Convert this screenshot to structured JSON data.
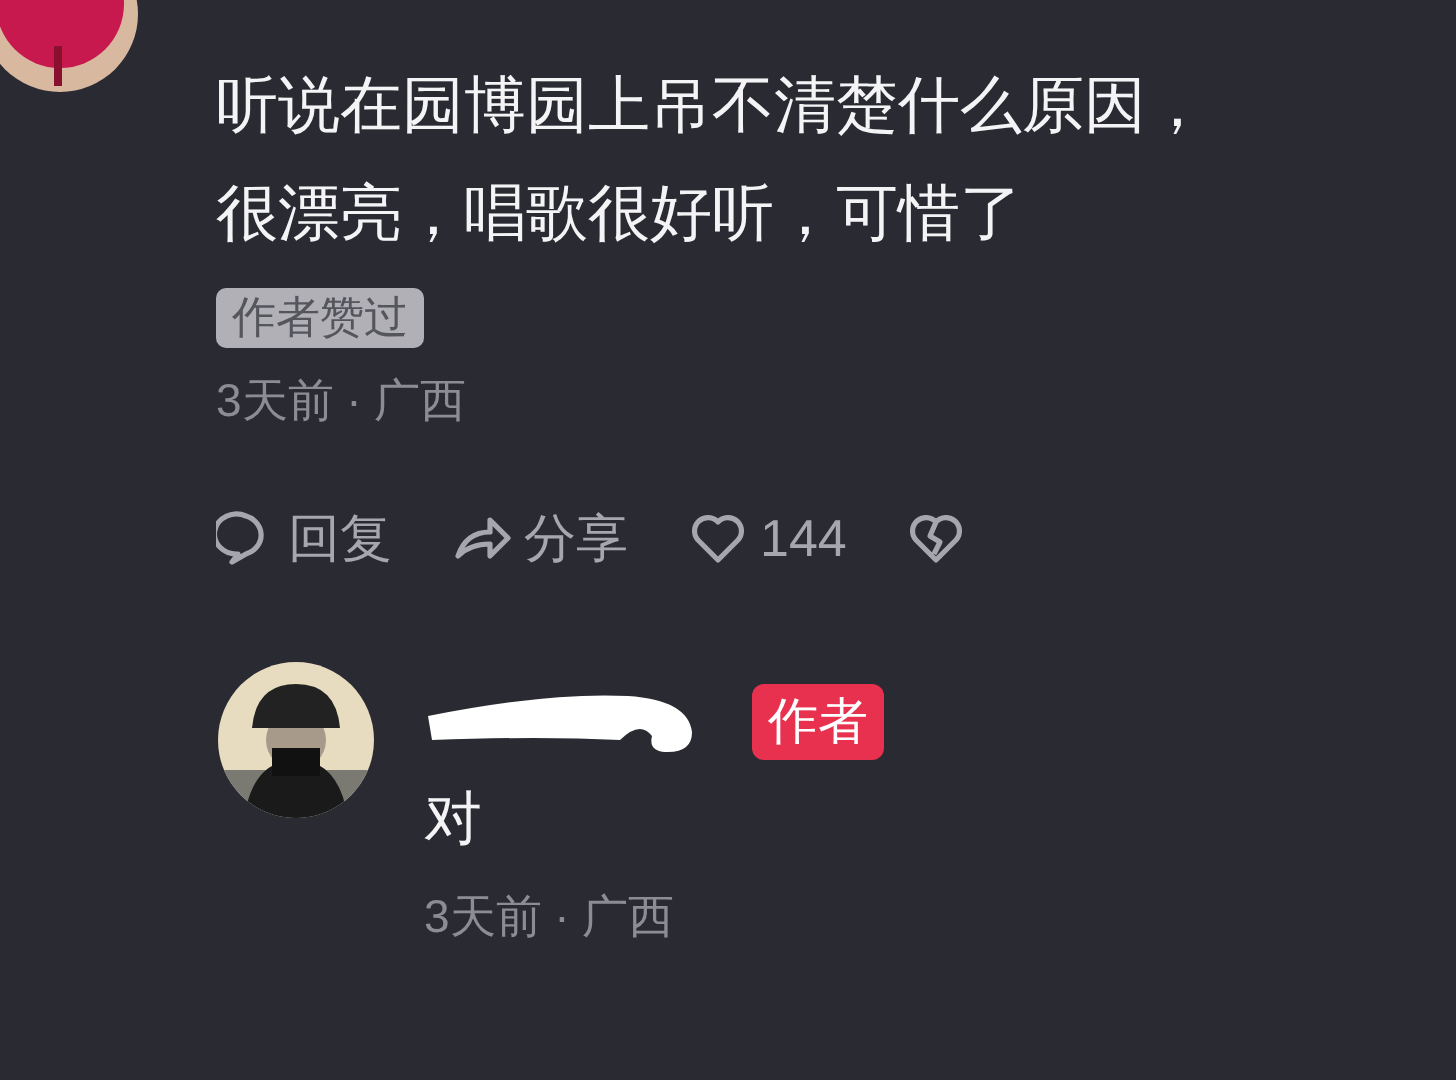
{
  "comment": {
    "text": "听说在园博园上吊不清楚什么原因，很漂亮，唱歌很好听，可惜了",
    "badge": "作者赞过",
    "meta": "3天前 · 广西",
    "actions": [
      {
        "kind": "reply",
        "label": "回复"
      },
      {
        "kind": "share",
        "label": "分享"
      },
      {
        "kind": "like",
        "label": "144"
      },
      {
        "kind": "dislike"
      }
    ]
  },
  "reply": {
    "badge": "作者",
    "text": "对",
    "meta": "3天前 · 广西"
  }
}
